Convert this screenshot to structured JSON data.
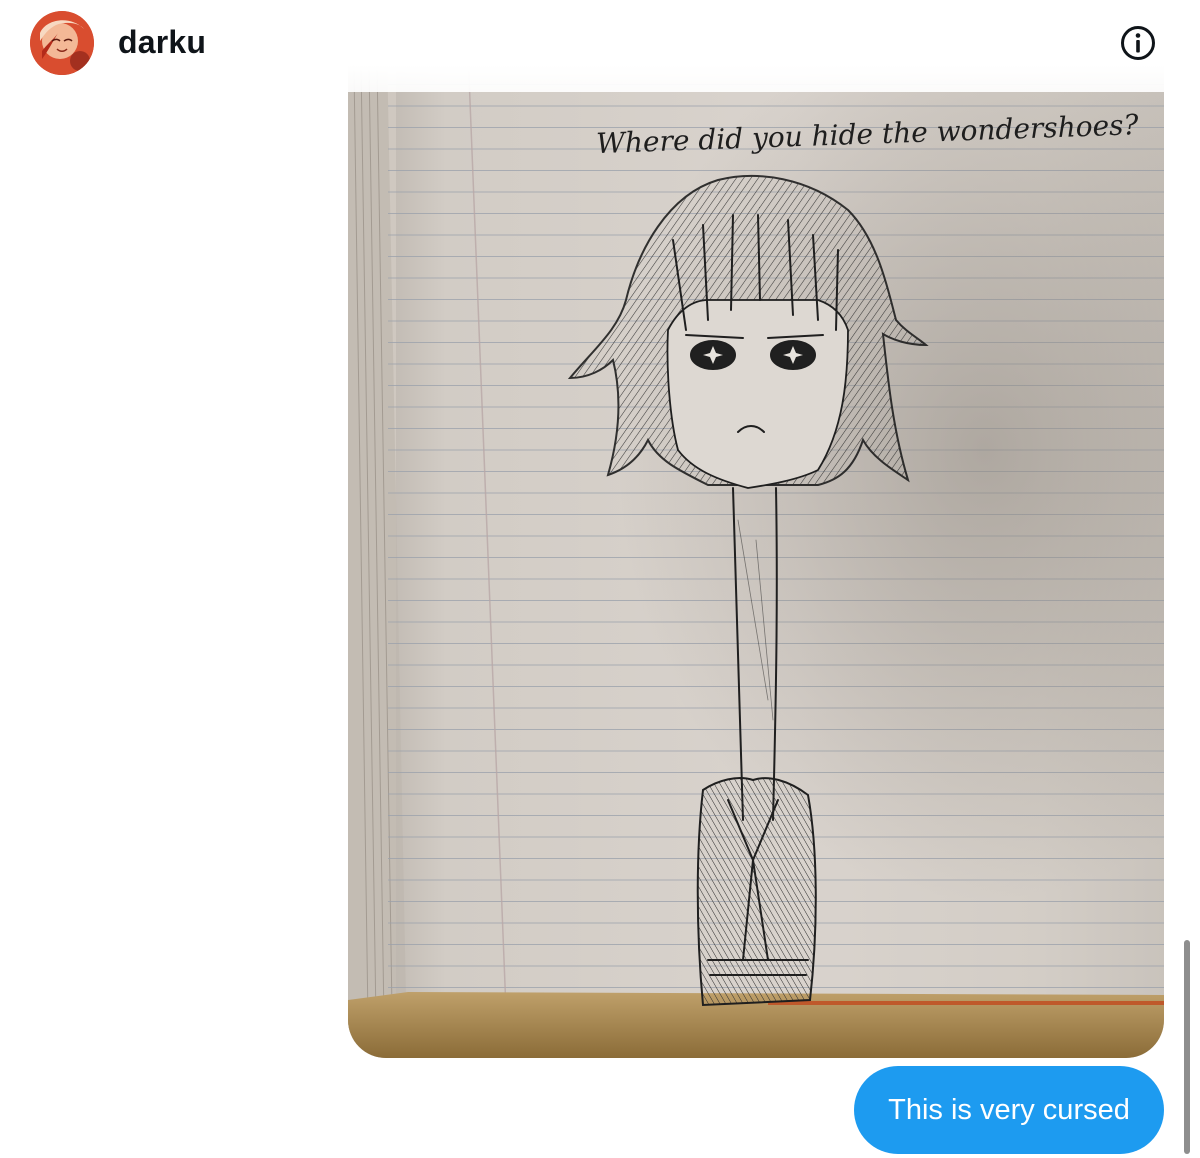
{
  "conversation": {
    "username": "darku",
    "avatar_icon": "avatar-image",
    "info_icon": "info-circle-icon"
  },
  "image_message": {
    "handwritten_caption": "Where did you hide the wondershoes?",
    "icon": "sketch-photo"
  },
  "sent_message": {
    "text": "This is very cursed",
    "color": "#1d9bf0"
  },
  "colors": {
    "accent": "#1d9bf0",
    "text_primary": "#0f1419"
  }
}
